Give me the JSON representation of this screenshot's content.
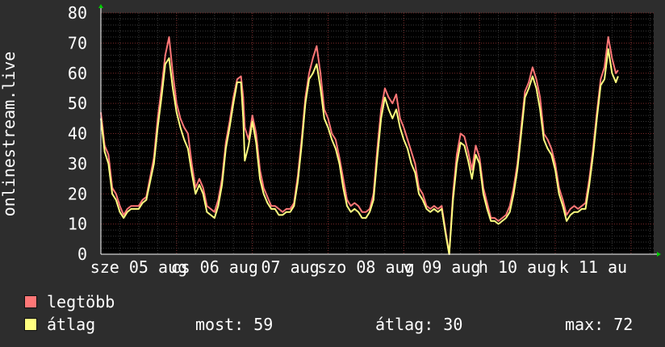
{
  "chart_data": {
    "type": "line",
    "ylabel": "onlinestream.live",
    "ylim": [
      0,
      80
    ],
    "yticks": [
      0,
      10,
      20,
      30,
      40,
      50,
      60,
      70,
      80
    ],
    "grid": true,
    "legend_placement": "bottom-left",
    "xticks": [
      {
        "x": 0.5,
        "label": "sze 05 aug"
      },
      {
        "x": 1.5,
        "label": "cs 06 aug"
      },
      {
        "x": 2.5,
        "label": "07 aug"
      },
      {
        "x": 3.5,
        "label": "szo 08 aug"
      },
      {
        "x": 4.5,
        "label": "v 09 aug"
      },
      {
        "x": 5.5,
        "label": "h 10 aug"
      },
      {
        "x": 6.5,
        "label": "k 11 au"
      }
    ],
    "x_range": [
      0,
      7.3
    ],
    "series": [
      {
        "name": "legtöbb",
        "color": "#ff7777",
        "points": [
          [
            0.0,
            47
          ],
          [
            0.05,
            36
          ],
          [
            0.1,
            33
          ],
          [
            0.15,
            22
          ],
          [
            0.2,
            20
          ],
          [
            0.25,
            16
          ],
          [
            0.3,
            13
          ],
          [
            0.35,
            15
          ],
          [
            0.4,
            16
          ],
          [
            0.5,
            16
          ],
          [
            0.55,
            18
          ],
          [
            0.6,
            19
          ],
          [
            0.7,
            32
          ],
          [
            0.75,
            45
          ],
          [
            0.8,
            55
          ],
          [
            0.85,
            66
          ],
          [
            0.9,
            72
          ],
          [
            0.95,
            60
          ],
          [
            1.0,
            50
          ],
          [
            1.05,
            45
          ],
          [
            1.1,
            42
          ],
          [
            1.15,
            40
          ],
          [
            1.2,
            30
          ],
          [
            1.25,
            22
          ],
          [
            1.3,
            25
          ],
          [
            1.35,
            22
          ],
          [
            1.4,
            16
          ],
          [
            1.45,
            15
          ],
          [
            1.5,
            14
          ],
          [
            1.55,
            18
          ],
          [
            1.6,
            25
          ],
          [
            1.65,
            37
          ],
          [
            1.7,
            44
          ],
          [
            1.75,
            52
          ],
          [
            1.8,
            58
          ],
          [
            1.85,
            59
          ],
          [
            1.88,
            52
          ],
          [
            1.9,
            42
          ],
          [
            1.95,
            38
          ],
          [
            2.0,
            46
          ],
          [
            2.05,
            40
          ],
          [
            2.1,
            28
          ],
          [
            2.15,
            22
          ],
          [
            2.2,
            19
          ],
          [
            2.25,
            16
          ],
          [
            2.3,
            16
          ],
          [
            2.35,
            15
          ],
          [
            2.4,
            14
          ],
          [
            2.45,
            15
          ],
          [
            2.5,
            15
          ],
          [
            2.55,
            17
          ],
          [
            2.6,
            26
          ],
          [
            2.65,
            38
          ],
          [
            2.7,
            52
          ],
          [
            2.75,
            60
          ],
          [
            2.8,
            65
          ],
          [
            2.85,
            69
          ],
          [
            2.9,
            60
          ],
          [
            2.95,
            48
          ],
          [
            3.0,
            45
          ],
          [
            3.05,
            40
          ],
          [
            3.1,
            38
          ],
          [
            3.15,
            32
          ],
          [
            3.2,
            25
          ],
          [
            3.25,
            18
          ],
          [
            3.3,
            16
          ],
          [
            3.35,
            17
          ],
          [
            3.4,
            16
          ],
          [
            3.45,
            14
          ],
          [
            3.5,
            14
          ],
          [
            3.55,
            15
          ],
          [
            3.6,
            20
          ],
          [
            3.65,
            35
          ],
          [
            3.7,
            48
          ],
          [
            3.75,
            55
          ],
          [
            3.8,
            52
          ],
          [
            3.85,
            50
          ],
          [
            3.9,
            53
          ],
          [
            3.95,
            45
          ],
          [
            4.0,
            42
          ],
          [
            4.05,
            38
          ],
          [
            4.1,
            34
          ],
          [
            4.15,
            30
          ],
          [
            4.2,
            22
          ],
          [
            4.25,
            20
          ],
          [
            4.3,
            16
          ],
          [
            4.35,
            15
          ],
          [
            4.4,
            16
          ],
          [
            4.45,
            15
          ],
          [
            4.5,
            16
          ],
          [
            4.55,
            8
          ],
          [
            4.6,
            0
          ],
          [
            4.65,
            20
          ],
          [
            4.7,
            33
          ],
          [
            4.75,
            40
          ],
          [
            4.8,
            39
          ],
          [
            4.85,
            34
          ],
          [
            4.9,
            28
          ],
          [
            4.95,
            36
          ],
          [
            5.0,
            32
          ],
          [
            5.05,
            22
          ],
          [
            5.1,
            17
          ],
          [
            5.15,
            12
          ],
          [
            5.2,
            12
          ],
          [
            5.25,
            11
          ],
          [
            5.3,
            12
          ],
          [
            5.35,
            13
          ],
          [
            5.4,
            16
          ],
          [
            5.45,
            22
          ],
          [
            5.5,
            30
          ],
          [
            5.55,
            42
          ],
          [
            5.6,
            54
          ],
          [
            5.65,
            57
          ],
          [
            5.7,
            62
          ],
          [
            5.75,
            58
          ],
          [
            5.8,
            52
          ],
          [
            5.85,
            40
          ],
          [
            5.9,
            38
          ],
          [
            5.95,
            35
          ],
          [
            6.0,
            30
          ],
          [
            6.05,
            22
          ],
          [
            6.1,
            18
          ],
          [
            6.15,
            13
          ],
          [
            6.2,
            15
          ],
          [
            6.25,
            16
          ],
          [
            6.3,
            15
          ],
          [
            6.35,
            16
          ],
          [
            6.4,
            17
          ],
          [
            6.45,
            25
          ],
          [
            6.5,
            35
          ],
          [
            6.55,
            47
          ],
          [
            6.6,
            58
          ],
          [
            6.65,
            62
          ],
          [
            6.7,
            72
          ],
          [
            6.75,
            65
          ],
          [
            6.8,
            60
          ],
          [
            6.83,
            61
          ]
        ]
      },
      {
        "name": "átlag",
        "color": "#ffff80",
        "points": [
          [
            0.0,
            45
          ],
          [
            0.05,
            34
          ],
          [
            0.1,
            30
          ],
          [
            0.15,
            20
          ],
          [
            0.2,
            18
          ],
          [
            0.25,
            14
          ],
          [
            0.3,
            12
          ],
          [
            0.35,
            14
          ],
          [
            0.4,
            15
          ],
          [
            0.5,
            15
          ],
          [
            0.55,
            17
          ],
          [
            0.6,
            18
          ],
          [
            0.7,
            30
          ],
          [
            0.75,
            42
          ],
          [
            0.8,
            52
          ],
          [
            0.85,
            63
          ],
          [
            0.9,
            65
          ],
          [
            0.95,
            55
          ],
          [
            1.0,
            47
          ],
          [
            1.05,
            42
          ],
          [
            1.1,
            38
          ],
          [
            1.15,
            35
          ],
          [
            1.2,
            27
          ],
          [
            1.25,
            20
          ],
          [
            1.3,
            23
          ],
          [
            1.35,
            20
          ],
          [
            1.4,
            14
          ],
          [
            1.45,
            13
          ],
          [
            1.5,
            12
          ],
          [
            1.55,
            16
          ],
          [
            1.6,
            23
          ],
          [
            1.65,
            35
          ],
          [
            1.7,
            42
          ],
          [
            1.75,
            50
          ],
          [
            1.8,
            57
          ],
          [
            1.85,
            57
          ],
          [
            1.88,
            45
          ],
          [
            1.9,
            31
          ],
          [
            1.95,
            36
          ],
          [
            2.0,
            44
          ],
          [
            2.05,
            37
          ],
          [
            2.1,
            25
          ],
          [
            2.15,
            20
          ],
          [
            2.2,
            17
          ],
          [
            2.25,
            15
          ],
          [
            2.3,
            15
          ],
          [
            2.35,
            13
          ],
          [
            2.4,
            13
          ],
          [
            2.45,
            14
          ],
          [
            2.5,
            14
          ],
          [
            2.55,
            16
          ],
          [
            2.6,
            24
          ],
          [
            2.65,
            36
          ],
          [
            2.7,
            50
          ],
          [
            2.75,
            58
          ],
          [
            2.8,
            60
          ],
          [
            2.85,
            63
          ],
          [
            2.9,
            55
          ],
          [
            2.95,
            45
          ],
          [
            3.0,
            42
          ],
          [
            3.05,
            38
          ],
          [
            3.1,
            35
          ],
          [
            3.15,
            30
          ],
          [
            3.2,
            22
          ],
          [
            3.25,
            16
          ],
          [
            3.3,
            14
          ],
          [
            3.35,
            15
          ],
          [
            3.4,
            14
          ],
          [
            3.45,
            12
          ],
          [
            3.5,
            12
          ],
          [
            3.55,
            14
          ],
          [
            3.6,
            18
          ],
          [
            3.65,
            32
          ],
          [
            3.7,
            45
          ],
          [
            3.75,
            52
          ],
          [
            3.8,
            48
          ],
          [
            3.85,
            45
          ],
          [
            3.9,
            48
          ],
          [
            3.95,
            42
          ],
          [
            4.0,
            38
          ],
          [
            4.05,
            35
          ],
          [
            4.1,
            30
          ],
          [
            4.15,
            27
          ],
          [
            4.2,
            20
          ],
          [
            4.25,
            18
          ],
          [
            4.3,
            15
          ],
          [
            4.35,
            14
          ],
          [
            4.4,
            15
          ],
          [
            4.45,
            14
          ],
          [
            4.5,
            15
          ],
          [
            4.55,
            7
          ],
          [
            4.6,
            0
          ],
          [
            4.65,
            18
          ],
          [
            4.7,
            30
          ],
          [
            4.75,
            37
          ],
          [
            4.8,
            36
          ],
          [
            4.85,
            31
          ],
          [
            4.9,
            25
          ],
          [
            4.95,
            33
          ],
          [
            5.0,
            30
          ],
          [
            5.05,
            20
          ],
          [
            5.1,
            15
          ],
          [
            5.15,
            11
          ],
          [
            5.2,
            11
          ],
          [
            5.25,
            10
          ],
          [
            5.3,
            11
          ],
          [
            5.35,
            12
          ],
          [
            5.4,
            14
          ],
          [
            5.45,
            20
          ],
          [
            5.5,
            28
          ],
          [
            5.55,
            40
          ],
          [
            5.6,
            52
          ],
          [
            5.65,
            55
          ],
          [
            5.7,
            59
          ],
          [
            5.75,
            55
          ],
          [
            5.8,
            48
          ],
          [
            5.85,
            38
          ],
          [
            5.9,
            35
          ],
          [
            5.95,
            33
          ],
          [
            6.0,
            28
          ],
          [
            6.05,
            20
          ],
          [
            6.1,
            16
          ],
          [
            6.15,
            11
          ],
          [
            6.2,
            13
          ],
          [
            6.25,
            14
          ],
          [
            6.3,
            14
          ],
          [
            6.35,
            15
          ],
          [
            6.4,
            15
          ],
          [
            6.45,
            23
          ],
          [
            6.5,
            33
          ],
          [
            6.55,
            45
          ],
          [
            6.6,
            56
          ],
          [
            6.65,
            58
          ],
          [
            6.7,
            68
          ],
          [
            6.75,
            60
          ],
          [
            6.8,
            57
          ],
          [
            6.83,
            59
          ]
        ]
      }
    ]
  },
  "legend": {
    "max_series": "legtöbb",
    "avg_series": "átlag",
    "now_text": "most: 59",
    "avg_text": "átlag: 30",
    "max_text": "max: 72",
    "max_color": "#ff7777",
    "avg_color": "#ffff80"
  }
}
